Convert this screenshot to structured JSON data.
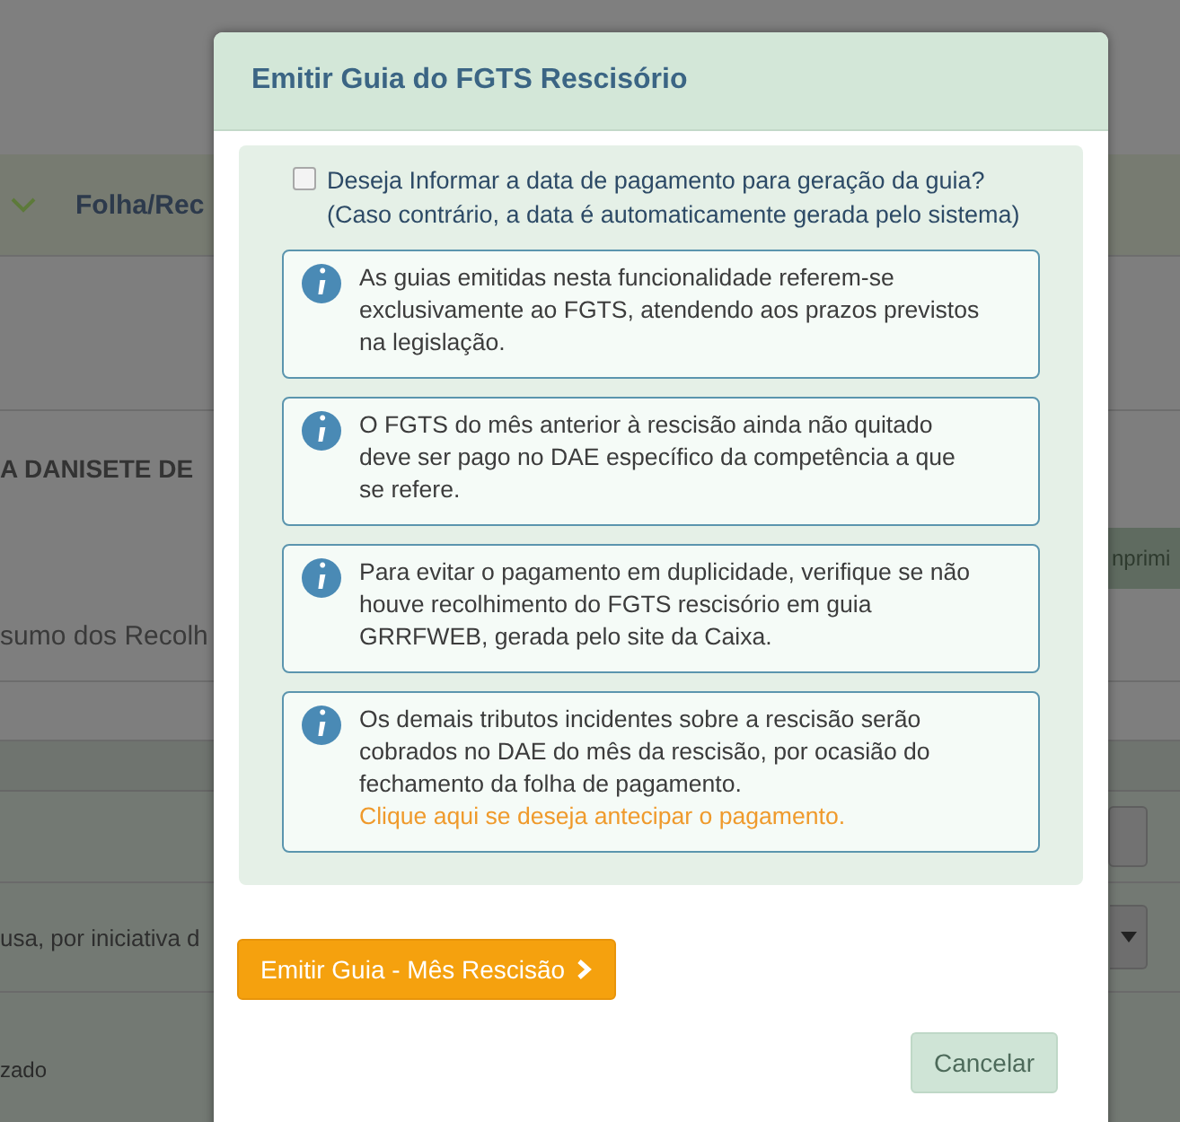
{
  "background": {
    "nav_label": "Folha/Rec",
    "employer_name": "A DANISETE DE",
    "print_button": "nprimi",
    "section_title": "sumo dos Recolh",
    "select_value": "usa, por iniciativa d",
    "footer_text": "zado"
  },
  "dialog": {
    "title": "Emitir Guia do FGTS Rescisório",
    "checkbox": {
      "label": "Deseja Informar a data de pagamento para geração da guia?",
      "note": "(Caso contrário, a data é automaticamente gerada pelo sistema)",
      "checked": false
    },
    "notices": [
      {
        "text": "As guias emitidas nesta funcionalidade referem-se exclusivamente ao FGTS, atendendo aos prazos previstos na legislação."
      },
      {
        "text": "O FGTS do mês anterior à rescisão ainda não quitado deve ser pago no DAE específico da competência a que se refere."
      },
      {
        "text": "Para evitar o pagamento em duplicidade, verifique se não houve recolhimento do FGTS rescisório em guia GRRFWEB, gerada pelo site da Caixa."
      },
      {
        "text": "Os demais tributos incidentes sobre a rescisão serão cobrados no DAE do mês da rescisão, por ocasião do fechamento da folha de pagamento.",
        "link": "Clique aqui se deseja antecipar o pagamento."
      }
    ],
    "buttons": [
      {
        "label": "Emitir Guia - Mês Rescisão",
        "kind": "primary"
      },
      {
        "label": "Cancelar",
        "kind": "secondary"
      }
    ]
  }
}
